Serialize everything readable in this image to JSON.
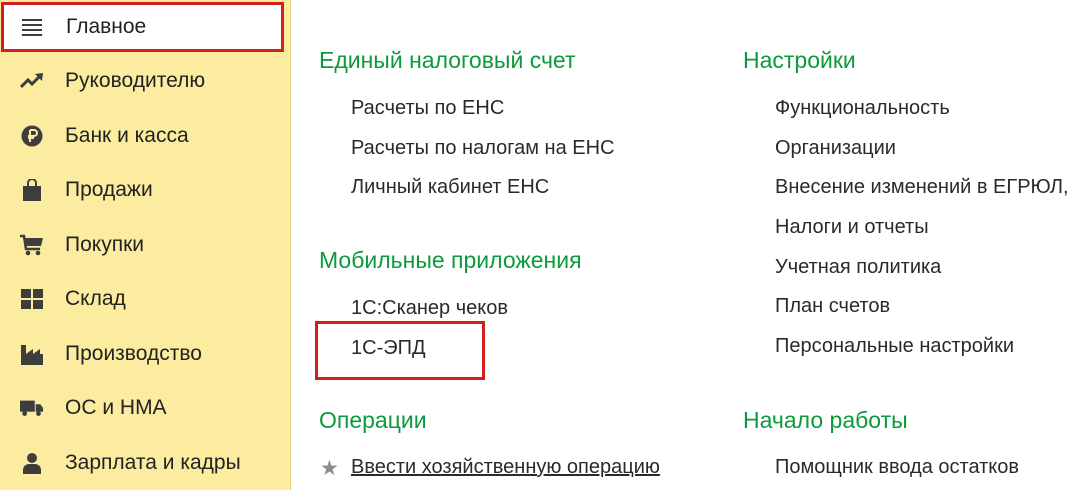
{
  "sidebar": {
    "items": [
      {
        "label": "Главное",
        "icon": "menu-icon"
      },
      {
        "label": "Руководителю",
        "icon": "trend-icon"
      },
      {
        "label": "Банк и касса",
        "icon": "ruble-coin-icon"
      },
      {
        "label": "Продажи",
        "icon": "shopping-bag-icon"
      },
      {
        "label": "Покупки",
        "icon": "cart-icon"
      },
      {
        "label": "Склад",
        "icon": "warehouse-grid-icon"
      },
      {
        "label": "Производство",
        "icon": "factory-icon"
      },
      {
        "label": "ОС и НМА",
        "icon": "truck-icon"
      },
      {
        "label": "Зарплата и кадры",
        "icon": "person-icon"
      }
    ],
    "active_index": 0
  },
  "sections": {
    "ens": {
      "title": "Единый налоговый счет",
      "links": [
        "Расчеты по ЕНС",
        "Расчеты по налогам на ЕНС",
        "Личный кабинет ЕНС"
      ]
    },
    "mobile": {
      "title": "Мобильные приложения",
      "links": [
        "1С:Сканер чеков",
        "1С-ЭПД"
      ]
    },
    "operations": {
      "title": "Операции",
      "links": [
        "Ввести хозяйственную операцию"
      ]
    },
    "settings": {
      "title": "Настройки",
      "links": [
        "Функциональность",
        "Организации",
        "Внесение изменений в ЕГРЮЛ,",
        "Налоги и отчеты",
        "Учетная политика",
        "План счетов",
        "Персональные настройки"
      ]
    },
    "start": {
      "title": "Начало работы",
      "links": [
        "Помощник ввода остатков"
      ]
    }
  },
  "colors": {
    "sidebar_bg": "#fbeca0",
    "section_title": "#0c9a3c",
    "highlight": "#d31f1f",
    "icon": "#3d3d3d"
  }
}
